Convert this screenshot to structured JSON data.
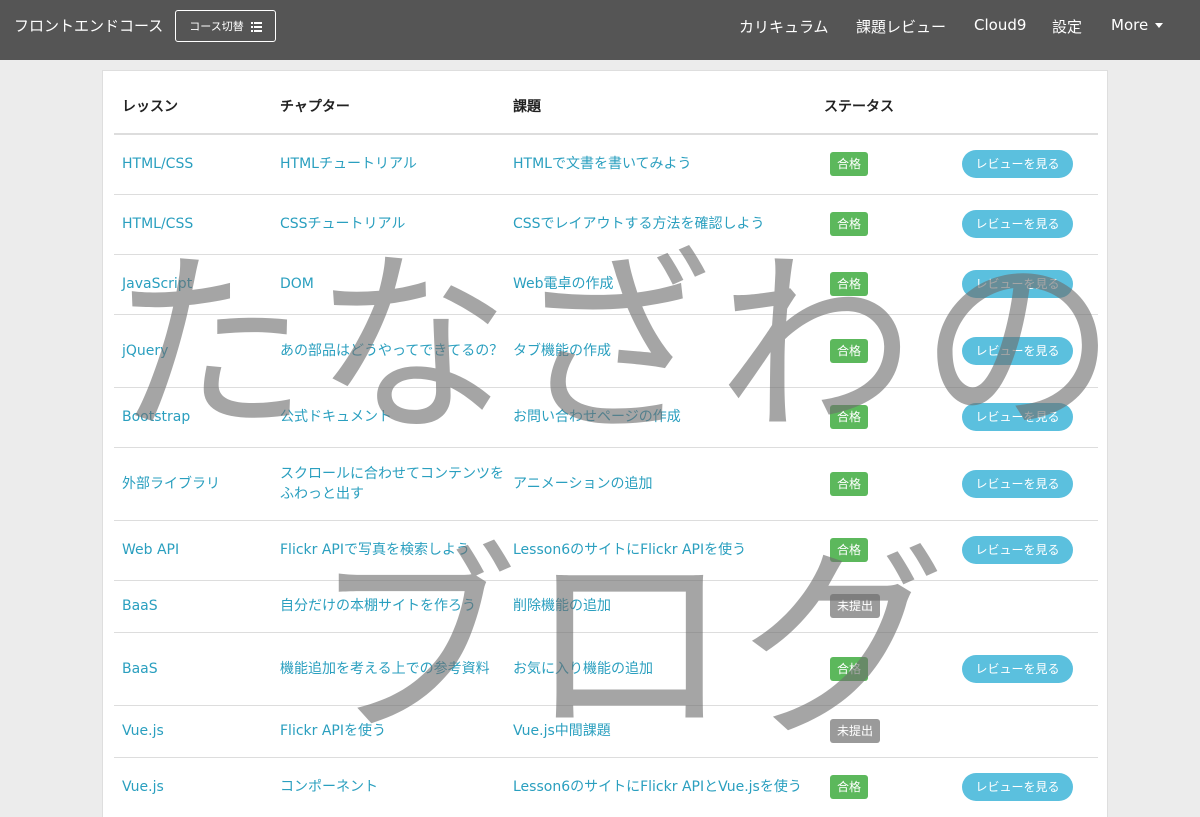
{
  "header": {
    "course_title": "フロントエンドコース",
    "course_switch_label": "コース切替",
    "nav": [
      "カリキュラム",
      "課題レビュー",
      "Cloud9",
      "設定"
    ],
    "more_label": "More",
    "background_color": "#555555"
  },
  "table": {
    "headers": {
      "lesson": "レッスン",
      "chapter": "チャプター",
      "task": "課題",
      "status": "ステータス"
    },
    "rows": [
      {
        "lesson": "HTML/CSS",
        "chapter": "HTMLチュートリアル",
        "task": "HTMLで文書を書いてみよう",
        "status": "合格",
        "review": "レビューを見る"
      },
      {
        "lesson": "HTML/CSS",
        "chapter": "CSSチュートリアル",
        "task": "CSSでレイアウトする方法を確認しよう",
        "status": "合格",
        "review": "レビューを見る"
      },
      {
        "lesson": "JavaScript",
        "chapter": "DOM",
        "task": "Web電卓の作成",
        "status": "合格",
        "review": "レビューを見る"
      },
      {
        "lesson": "jQuery",
        "chapter": "あの部品はどうやってできてるの？",
        "task": "タブ機能の作成",
        "status": "合格",
        "review": "レビューを見る"
      },
      {
        "lesson": "Bootstrap",
        "chapter": "公式ドキュメント",
        "task": "お問い合わせページの作成",
        "status": "合格",
        "review": "レビューを見る"
      },
      {
        "lesson": "外部ライブラリ",
        "chapter": "スクロールに合わせてコンテンツをふわっと出す",
        "task": "アニメーションの追加",
        "status": "合格",
        "review": "レビューを見る"
      },
      {
        "lesson": "Web API",
        "chapter": "Flickr APIで写真を検索しよう",
        "task": "Lesson6のサイトにFlickr APIを使う",
        "status": "合格",
        "review": "レビューを見る"
      },
      {
        "lesson": "BaaS",
        "chapter": "自分だけの本棚サイトを作ろう",
        "task": "削除機能の追加",
        "status": "未提出",
        "review": ""
      },
      {
        "lesson": "BaaS",
        "chapter": "機能追加を考える上での参考資料",
        "task": "お気に入り機能の追加",
        "status": "合格",
        "review": "レビューを見る"
      },
      {
        "lesson": "Vue.js",
        "chapter": "Flickr APIを使う",
        "task": "Vue.js中間課題",
        "status": "未提出",
        "review": ""
      },
      {
        "lesson": "Vue.js",
        "chapter": "コンポーネント",
        "task": "Lesson6のサイトにFlickr APIとVue.jsを使う",
        "status": "合格",
        "review": "レビューを見る"
      }
    ]
  },
  "colors": {
    "link": "#2a9fbf",
    "pass_badge": "#5cb85c",
    "pending_badge": "#9a9a9a",
    "review_button": "#5bc0de"
  },
  "watermark": {
    "line1": "たなざわの",
    "line2": "ブログ"
  }
}
